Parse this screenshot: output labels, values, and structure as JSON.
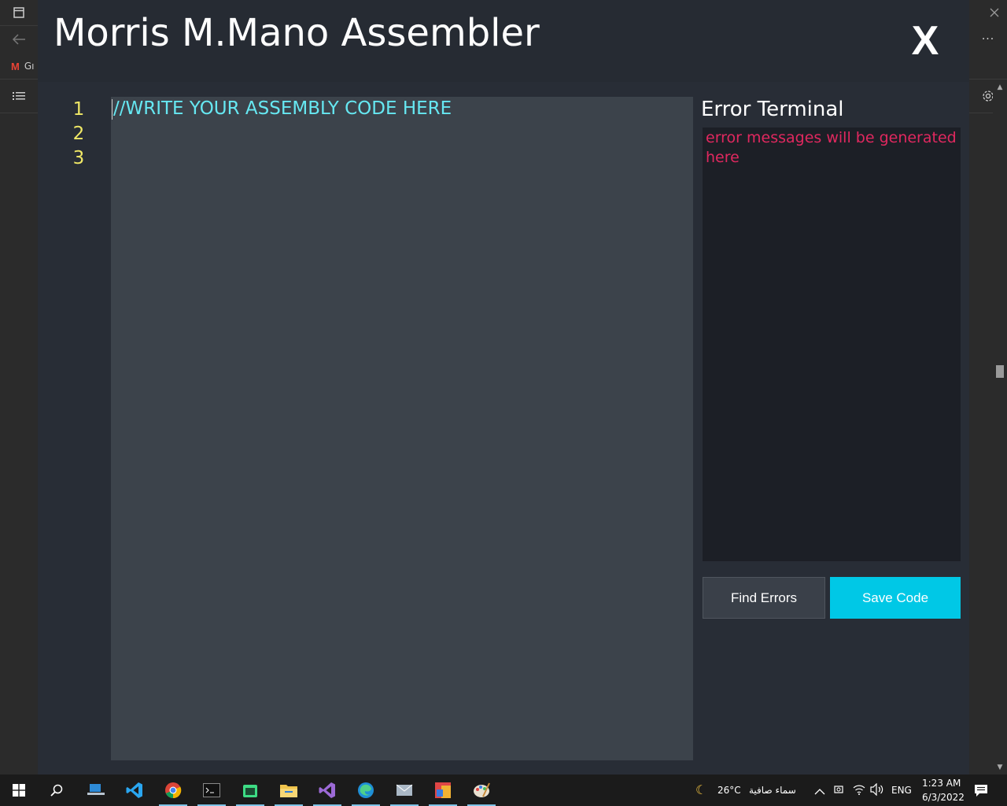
{
  "app": {
    "title": "Morris M.Mano Assembler",
    "close_label": "X"
  },
  "editor": {
    "line_numbers": [
      "1",
      "2",
      "3"
    ],
    "content": "//WRITE YOUR ASSEMBLY CODE HERE"
  },
  "terminal": {
    "title": "Error Terminal",
    "placeholder": "error messages will be generated here"
  },
  "buttons": {
    "find_errors": "Find Errors",
    "save_code": "Save Code"
  },
  "browser": {
    "bookmark_label": "Gı"
  },
  "taskbar": {
    "weather_temp": "26°C",
    "weather_text": "سماء صافية",
    "language": "ENG",
    "time": "1:23 AM",
    "date": "6/3/2022"
  },
  "colors": {
    "app_bg": "#282d36",
    "editor_bg": "#3c434b",
    "code_text": "#66e8f2",
    "line_numbers": "#f0e866",
    "terminal_bg": "#1c1f26",
    "error_text": "#e0285f",
    "save_button": "#00c8e6"
  }
}
